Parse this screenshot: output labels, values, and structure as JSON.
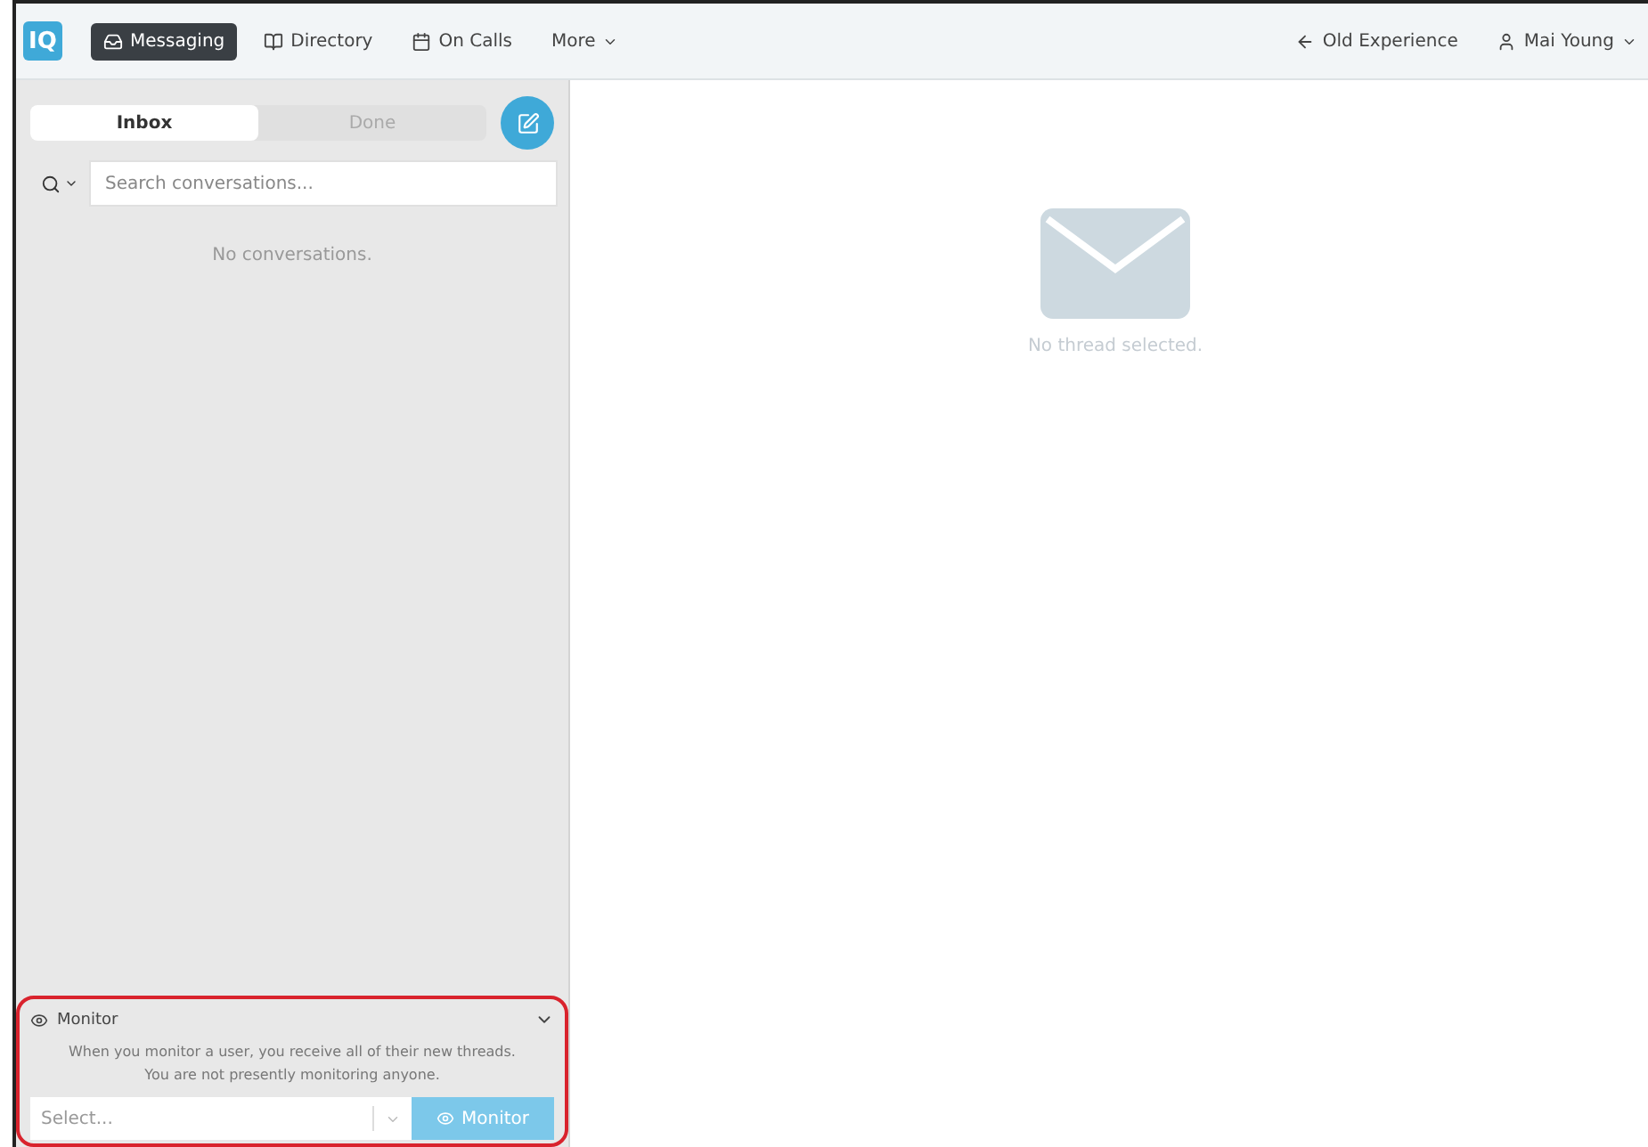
{
  "nav": {
    "logo": "IQ",
    "items": [
      {
        "label": "Messaging",
        "selected": true,
        "dropdown": false
      },
      {
        "label": "Directory",
        "selected": false,
        "dropdown": false
      },
      {
        "label": "On Calls",
        "selected": false,
        "dropdown": false
      },
      {
        "label": "More",
        "selected": false,
        "dropdown": true
      }
    ],
    "right": [
      {
        "label": "Old Experience",
        "dropdown": false
      },
      {
        "label": "Mai Young",
        "dropdown": true
      }
    ]
  },
  "sidebar": {
    "tabs": [
      {
        "label": "Inbox",
        "selected": true
      },
      {
        "label": "Done",
        "selected": false
      }
    ],
    "search": {
      "placeholder": "Search conversations..."
    },
    "empty": "No conversations.",
    "monitor": {
      "title": "Monitor",
      "expanded": true,
      "highlighted": true,
      "description": [
        "When you monitor a user, you receive all of their new threads.",
        "You are not presently monitoring anyone."
      ],
      "select": {
        "placeholder": "Select..."
      },
      "button": "Monitor"
    }
  },
  "main": {
    "empty": "No thread selected."
  }
}
